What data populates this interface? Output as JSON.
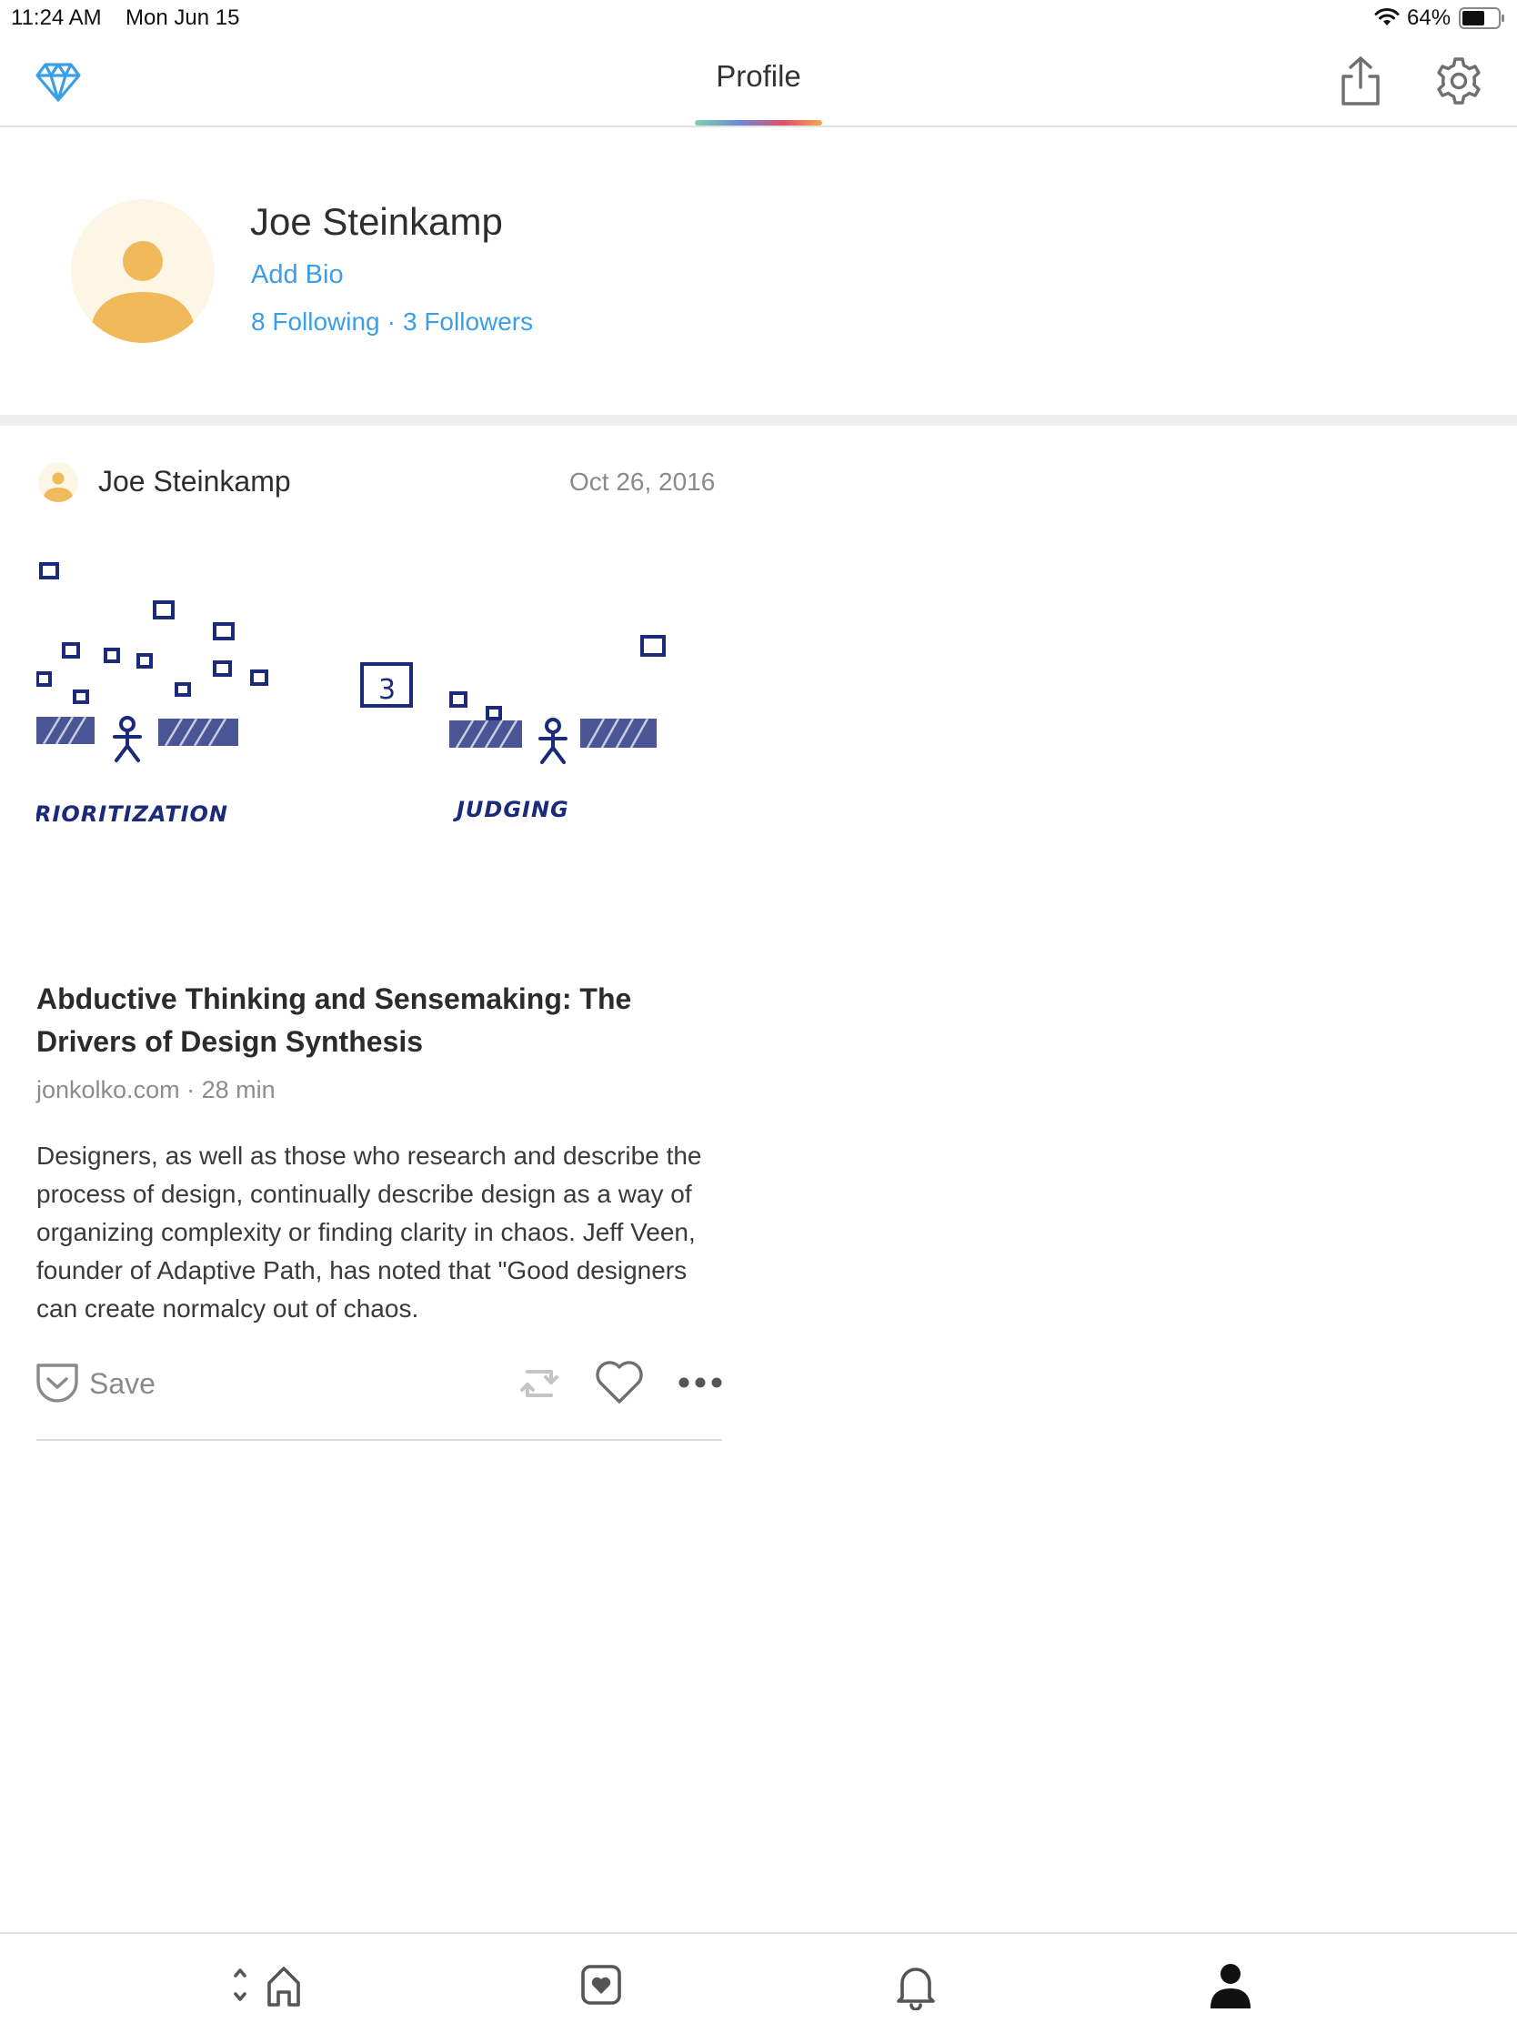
{
  "status_bar": {
    "time": "11:24 AM",
    "date": "Mon Jun 15",
    "battery_percent": "64%",
    "battery_level": 0.64
  },
  "header": {
    "title": "Profile",
    "icons": [
      "diamond-icon",
      "share-icon",
      "gear-icon"
    ]
  },
  "profile": {
    "name": "Joe Steinkamp",
    "add_bio": "Add Bio",
    "following": "8 Following",
    "separator": "·",
    "followers": "3 Followers"
  },
  "post": {
    "author": "Joe Steinkamp",
    "date": "Oct 26, 2016",
    "image_labels": [
      "RIORITIZATION",
      "JUDGING",
      "3"
    ],
    "title": "Abductive Thinking and Sensemaking: The Drivers of Design Synthesis",
    "meta": "jonkolko.com · 28 min",
    "excerpt": "Designers, as well as those who research and describe the process of design, continually describe design as a way of organizing complexity or finding clarity in chaos. Jeff Veen, founder of Adaptive Path, has noted that \"Good designers can create normalcy out of chaos.",
    "save_label": "Save"
  },
  "tab_bar": {
    "tabs": [
      "home-icon",
      "bookmark-icon",
      "bell-icon",
      "person-icon"
    ],
    "active": "person-icon"
  },
  "colors": {
    "link_blue": "#3b9ee8",
    "avatar_orange": "#f0b95a",
    "avatar_bg": "#fdf6e6",
    "ink_blue": "#1c2a7a"
  }
}
